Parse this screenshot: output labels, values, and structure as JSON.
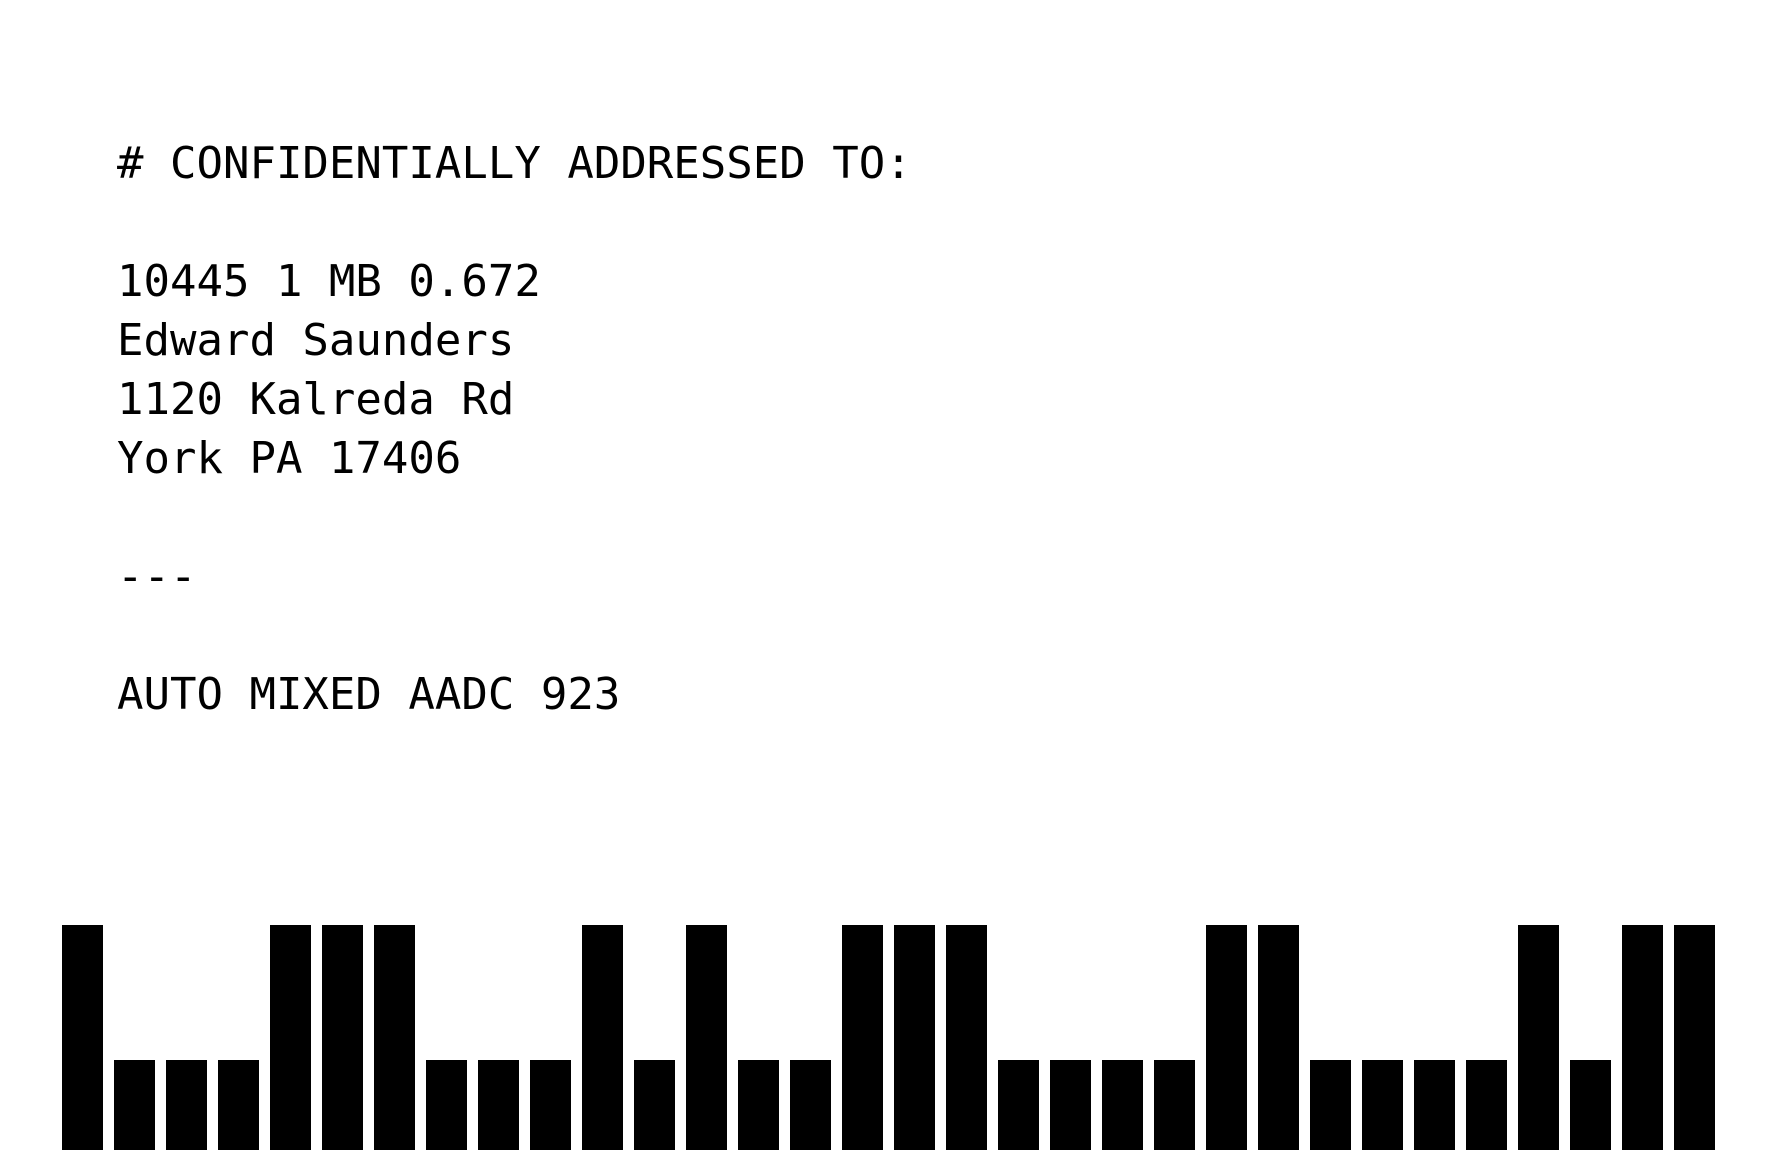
{
  "label": {
    "heading": "# CONFIDENTIALLY ADDRESSED TO:",
    "address_lines": [
      "10445 1 MB 0.672",
      "Edward Saunders",
      "1120 Kalreda Rd",
      "York PA 17406"
    ],
    "separator": "---",
    "sort_line": "AUTO MIXED AADC 923"
  },
  "barcode": {
    "bars": [
      "T",
      "S",
      "S",
      "S",
      "T",
      "T",
      "T",
      "S",
      "S",
      "S",
      "T",
      "S",
      "T",
      "S",
      "S",
      "T",
      "T",
      "T",
      "S",
      "S",
      "S",
      "S",
      "T",
      "T",
      "S",
      "S",
      "S",
      "S",
      "T",
      "S",
      "T",
      "T"
    ]
  }
}
